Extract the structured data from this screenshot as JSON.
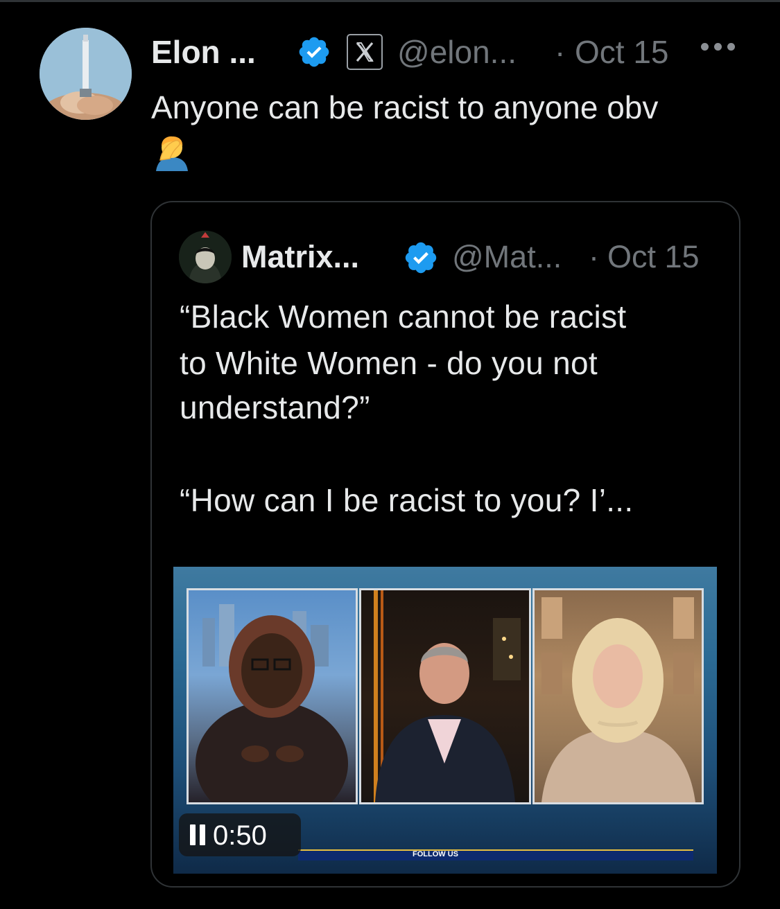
{
  "post": {
    "author_name": "Elon ...",
    "handle": "@elon...",
    "separator": "·",
    "timestamp": "Oct 15",
    "text": "Anyone can be racist to anyone obv",
    "emoji_name": "person-facepalming",
    "verified_color": "#1d9bf0"
  },
  "quoted_post": {
    "author_name": "Matrix...",
    "handle": "@Mat...",
    "separator": "·",
    "timestamp": "Oct 15",
    "text_lines": [
      "“Black Women cannot be racist",
      "to White Women - do you not",
      "understand?”",
      "“How can I be racist to you?  I’..."
    ],
    "video": {
      "duration": "0:50",
      "state": "playing",
      "ticker_text": "FOLLOW US"
    }
  },
  "icons": {
    "verified": "verified-badge-icon",
    "x_logo": "x-logo-icon",
    "more": "more-options-icon",
    "pause": "pause-icon"
  }
}
